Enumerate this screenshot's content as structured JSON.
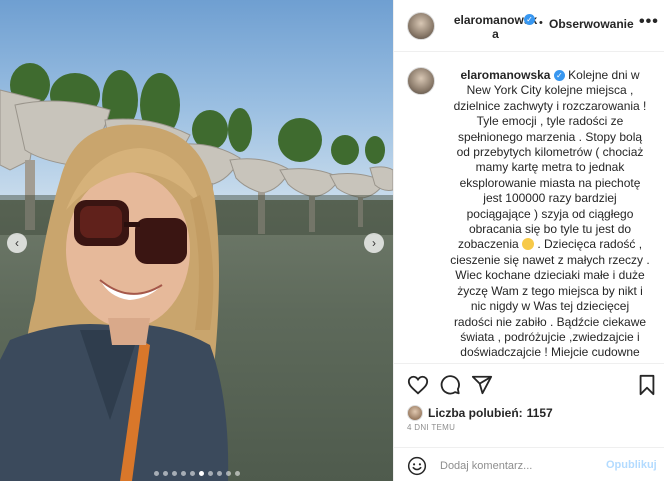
{
  "post": {
    "username": "elaromanowska",
    "header_username_line1": "elaromanowsk",
    "header_username_line2": "a",
    "separator": "•",
    "follow_label": "Obserwowanie",
    "more_label": "•••",
    "verified_glyph": "✓"
  },
  "media": {
    "prev_label": "‹",
    "next_label": "›",
    "slide_count": 10,
    "active_slide": 6
  },
  "caption": {
    "part1": " Kolejne dni w New York City kolejne miejsca , dzielnice zachwyty i rozczarowania ! Tyle emocji , tyle radości ze spełnionego marzenia . Stopy bolą od przebytych kilometrów ( chociaż mamy kartę metra to jednak eksplorowanie miasta na piechotę jest 100000 razy bardziej pociągające ) szyja od ciągłego obracania się bo tyle tu jest do zobaczenia ",
    "emoji_name": "grinning-face-emoji",
    "part2": " . Dziecięca radość , cieszenie się nawet z małych rzeczy . Wiec kochane dzieciaki małe i duże życzę Wam z tego miejsca by nikt i nic nigdy w Was tej dziecięcej radości nie zabiło . Bądźcie ciekawe świata , podróżujcie ,zwiedzajcie i doświadczajcie ! Miejcie cudowne marzenia i realizujcie je !!! A ja lecę uczcić ten dzień dziecka z cudowna , madra i piekielnie zdolna"
  },
  "engagement": {
    "likes_label": "Liczba polubień:",
    "likes_count": "1157",
    "time_ago": "4 DNI TEMU"
  },
  "comment": {
    "placeholder": "Dodaj komentarz...",
    "publish_label": "Opublikuj"
  },
  "icons": {
    "like": "heart-icon",
    "comment": "comment-icon",
    "share": "share-icon",
    "save": "bookmark-icon",
    "emoji": "smile-icon"
  },
  "colors": {
    "verified": "#3897f0",
    "publish_disabled": "#b3dbff"
  }
}
